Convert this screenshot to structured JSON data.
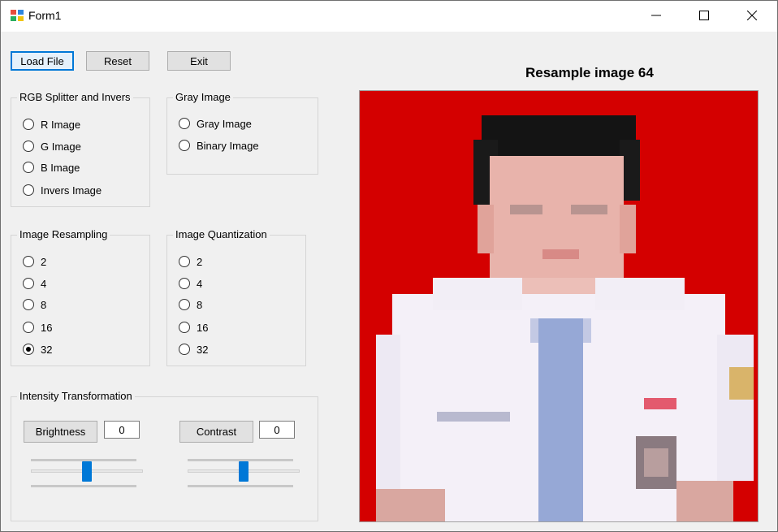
{
  "window": {
    "title": "Form1",
    "accent": "#0078d7"
  },
  "toolbar": {
    "load": "Load File",
    "reset": "Reset",
    "exit": "Exit"
  },
  "groups": {
    "rgb": {
      "title": "RGB Splitter and Invers",
      "options": [
        "R Image",
        "G Image",
        "B Image",
        "Invers Image"
      ]
    },
    "gray": {
      "title": "Gray Image",
      "options": [
        "Gray Image",
        "Binary Image"
      ]
    },
    "resampling": {
      "title": "Image Resampling",
      "options": [
        "2",
        "4",
        "8",
        "16",
        "32"
      ],
      "selected": "32"
    },
    "quantization": {
      "title": "Image Quantization",
      "options": [
        "2",
        "4",
        "8",
        "16",
        "32"
      ]
    },
    "intensity": {
      "title": "Intensity Transformation",
      "brightness": {
        "label": "Brightness",
        "value": "0",
        "slider_level": 0.5
      },
      "contrast": {
        "label": "Contrast",
        "value": "0",
        "slider_level": 0.5
      }
    }
  },
  "preview": {
    "heading": "Resample image 64",
    "background_color": "#d40000"
  }
}
